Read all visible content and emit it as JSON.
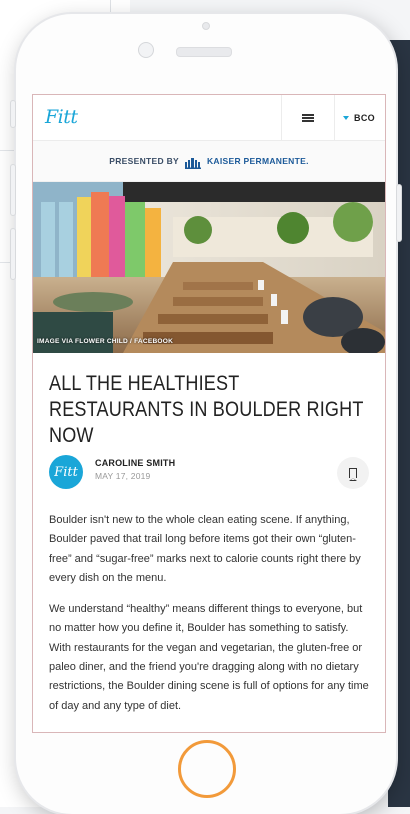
{
  "navbar": {
    "logo": "Fitt",
    "city": "BCO"
  },
  "sponsor": {
    "label": "PRESENTED BY",
    "name": "KAISER PERMANENTE."
  },
  "hero": {
    "caption": "IMAGE VIA FLOWER CHILD / FACEBOOK"
  },
  "article": {
    "title": "ALL THE HEALTHIEST RESTAURANTS IN BOULDER RIGHT NOW",
    "author_avatar": "Fitt",
    "author": "CAROLINE SMITH",
    "date": "MAY 17, 2019",
    "paragraphs": [
      "Boulder isn't new to the whole clean eating scene. If anything, Boulder paved that trail long before items got their own “gluten-free” and “sugar-free” marks next to calorie counts right there by every dish on the menu.",
      "We understand “healthy” means different things to everyone, but no matter how you define it, Boulder has something to satisfy. With restaurants for the vegan and vegetarian, the gluten-free or paleo diner, and the friend you're dragging along with no dietary restrictions, the Boulder dining scene is full of options for any time of day and any type of diet."
    ]
  },
  "colors": {
    "accent": "#1aa6d8",
    "home_ring": "#f29a3a",
    "sponsor": "#1c5a99"
  },
  "icons": [
    "hamburger-icon",
    "caret-down-icon",
    "kaiser-logo-icon",
    "bookmark-icon"
  ]
}
